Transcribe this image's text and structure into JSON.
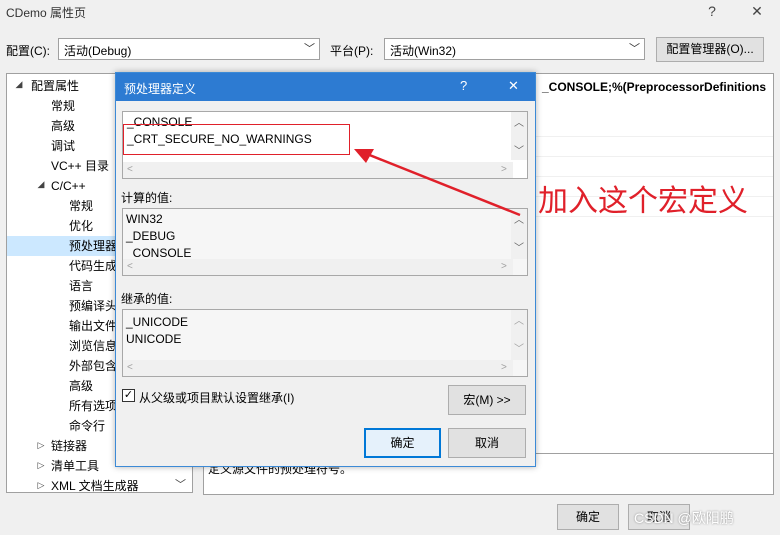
{
  "window": {
    "title": "CDemo 属性页",
    "help": "?",
    "close": "✕"
  },
  "toolbar": {
    "config_label": "配置(C):",
    "config_value": "活动(Debug)",
    "platform_label": "平台(P):",
    "platform_value": "活动(Win32)",
    "config_manager": "配置管理器(O)..."
  },
  "tree": {
    "items": [
      {
        "label": "配置属性"
      },
      {
        "label": "常规"
      },
      {
        "label": "高级"
      },
      {
        "label": "调试"
      },
      {
        "label": "VC++ 目录"
      },
      {
        "label": "C/C++"
      },
      {
        "label": "常规"
      },
      {
        "label": "优化"
      },
      {
        "label": "预处理器"
      },
      {
        "label": "代码生成"
      },
      {
        "label": "语言"
      },
      {
        "label": "预编译头"
      },
      {
        "label": "输出文件"
      },
      {
        "label": "浏览信息"
      },
      {
        "label": "外部包含"
      },
      {
        "label": "高级"
      },
      {
        "label": "所有选项"
      },
      {
        "label": "命令行"
      },
      {
        "label": "链接器"
      },
      {
        "label": "清单工具"
      },
      {
        "label": "XML 文档生成器"
      }
    ]
  },
  "propgrid": {
    "value": "_CONSOLE;%(PreprocessorDefinitions"
  },
  "desc": {
    "text": "定义源文件的预处理符号。"
  },
  "dialog": {
    "title": "预处理器定义",
    "help": "?",
    "close": "✕",
    "edit_lines": [
      "_CONSOLE",
      "_CRT_SECURE_NO_WARNINGS"
    ],
    "computed_label": "计算的值:",
    "computed_lines": [
      "WIN32",
      "_DEBUG",
      "_CONSOLE"
    ],
    "inherited_label": "继承的值:",
    "inherited_lines": [
      "_UNICODE",
      "UNICODE"
    ],
    "inherit_checkbox": "从父级或项目默认设置继承(I)",
    "macro_button": "宏(M) >>",
    "ok": "确定",
    "cancel": "取消"
  },
  "bottom": {
    "ok": "确定",
    "cancel": "取消"
  },
  "annotation": {
    "text": "加入这个宏定义",
    "color": "#e0202a"
  },
  "watermark": {
    "text": "CSDN @欧阳鹏"
  }
}
